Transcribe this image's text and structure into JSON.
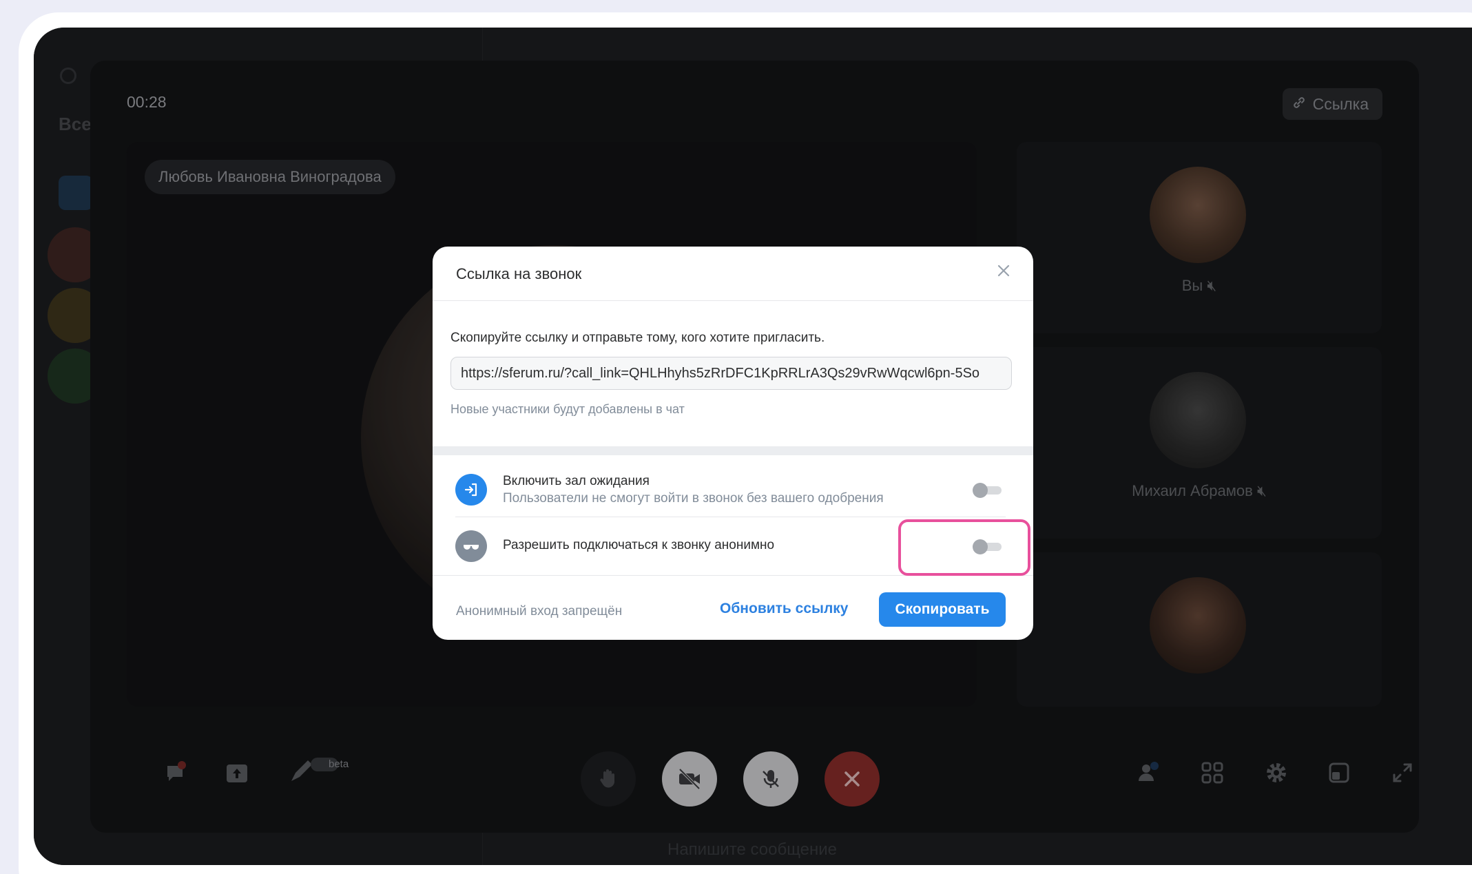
{
  "background_app": {
    "sidebar_tab": "Все",
    "message_placeholder": "Напишите сообщение"
  },
  "call": {
    "timer": "00:28",
    "link_button": "Ссылка",
    "speaker_name": "Любовь Ивановна Виноградова",
    "participants": [
      {
        "name": "Вы",
        "muted": true
      },
      {
        "name": "Михаил Абрамов",
        "muted": true
      },
      {
        "name": "",
        "muted": false
      }
    ],
    "beta_badge": "beta",
    "colors": {
      "end_call": "#c93a38",
      "control_bg": "#d9d9db"
    }
  },
  "modal": {
    "title": "Ссылка на звонок",
    "instruction": "Скопируйте ссылку и отправьте тому, кого хотите пригласить.",
    "url": "https://sferum.ru/?call_link=QHLHhyhs5zRrDFC1KpRRLrA3Qs29vRwWqcwl6pn-5So",
    "note": "Новые участники будут добавлены в чат",
    "waiting_room": {
      "title": "Включить зал ожидания",
      "subtitle": "Пользователи не смогут войти в звонок без вашего одобрения",
      "enabled": false
    },
    "anonymous": {
      "title": "Разрешить подключаться к звонку анонимно",
      "enabled": false
    },
    "footer_status": "Анонимный вход запрещён",
    "refresh_label": "Обновить ссылку",
    "copy_label": "Скопировать",
    "colors": {
      "primary": "#2688eb",
      "link": "#2d81e0",
      "highlight": "#e8509c"
    }
  }
}
